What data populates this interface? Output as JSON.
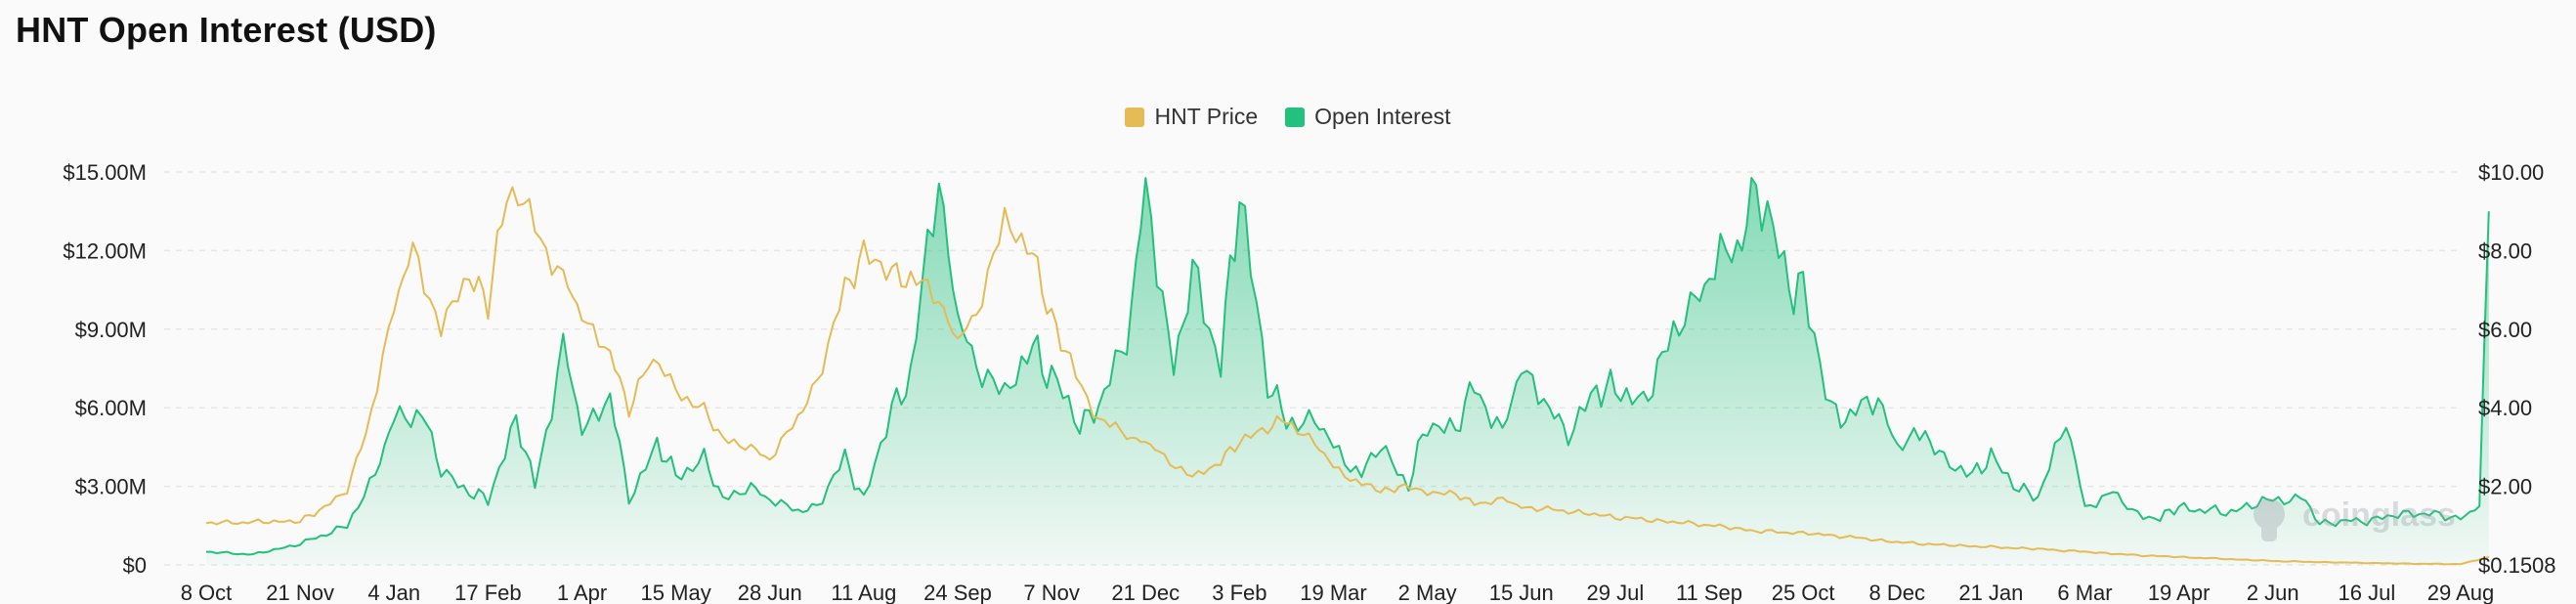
{
  "page": {
    "title": "HNT Open Interest (USD)"
  },
  "watermark": {
    "text": "coinglass"
  },
  "colors": {
    "price": "#e5bb55",
    "open_interest": "#23c07e",
    "grid": "#e6e6e6",
    "text": "#222222"
  },
  "chart_data": {
    "type": "line",
    "title": "HNT Open Interest (USD)",
    "legend_position": "top-center",
    "grid": true,
    "x_axis": {
      "ticks": [
        "8 Oct",
        "21 Nov",
        "4 Jan",
        "17 Feb",
        "1 Apr",
        "15 May",
        "28 Jun",
        "11 Aug",
        "24 Sep",
        "7 Nov",
        "21 Dec",
        "3 Feb",
        "19 Mar",
        "2 May",
        "15 Jun",
        "29 Jul",
        "11 Sep",
        "25 Oct",
        "8 Dec",
        "21 Jan",
        "6 Mar",
        "19 Apr",
        "2 Jun",
        "16 Jul",
        "29 Aug"
      ]
    },
    "y_left": {
      "range": [
        0,
        15000000
      ],
      "tick_labels": [
        "$0",
        "$3.00M",
        "$6.00M",
        "$9.00M",
        "$12.00M",
        "$15.00M"
      ]
    },
    "y_right": {
      "range": [
        0.1508,
        10
      ],
      "tick_labels": [
        "$0.1508",
        "$2.00",
        "$4.00",
        "$6.00",
        "$8.00",
        "$10.00"
      ]
    },
    "series": [
      {
        "name": "HNT Price",
        "axis": "right",
        "style": "line",
        "x_index": [
          0,
          1,
          1.2,
          1.5,
          1.7,
          2,
          2.2,
          2.5,
          2.8,
          3,
          3.2,
          3.5,
          3.8,
          4,
          4.3,
          4.5,
          4.7,
          5,
          5.3,
          5.5,
          5.8,
          6,
          6.3,
          6.5,
          6.8,
          7,
          7.3,
          7.5,
          7.8,
          8,
          8.2,
          8.5,
          8.8,
          9,
          9.2,
          9.5,
          9.8,
          10,
          10.2,
          10.5,
          10.8,
          11,
          11.3,
          11.5,
          11.8,
          12,
          12.3,
          12.5,
          12.7,
          13,
          13.3,
          13.5,
          13.8,
          14,
          14.5,
          15,
          15.5,
          16,
          16.5,
          17,
          17.5,
          18,
          18.5,
          19,
          19.5,
          20,
          20.5,
          21,
          21.5,
          22,
          22.5,
          23,
          23.5,
          24,
          24.3
        ],
        "values": [
          1.2,
          1.25,
          1.5,
          2.0,
          3.5,
          6.5,
          8.2,
          6.0,
          7.5,
          6.6,
          9.7,
          8.6,
          7.4,
          6.3,
          5.5,
          4.0,
          5.3,
          4.6,
          4.0,
          3.3,
          3.1,
          2.8,
          3.8,
          4.8,
          7.0,
          8.0,
          7.5,
          7.3,
          6.8,
          5.8,
          6.4,
          8.8,
          8.0,
          6.3,
          5.2,
          3.8,
          3.4,
          3.2,
          2.9,
          2.3,
          2.8,
          3.2,
          3.6,
          3.8,
          3.2,
          2.6,
          2.2,
          2.0,
          2.1,
          2.0,
          1.9,
          1.7,
          1.8,
          1.6,
          1.5,
          1.35,
          1.25,
          1.15,
          1.0,
          0.95,
          0.85,
          0.72,
          0.65,
          0.6,
          0.55,
          0.48,
          0.4,
          0.35,
          0.3,
          0.25,
          0.22,
          0.2,
          0.18,
          0.17,
          0.35
        ]
      },
      {
        "name": "Open Interest",
        "axis": "left",
        "style": "area",
        "x_index": [
          0,
          0.5,
          1,
          1.5,
          1.8,
          2,
          2.3,
          2.5,
          2.8,
          3,
          3.3,
          3.5,
          3.8,
          4,
          4.3,
          4.5,
          4.8,
          5,
          5.3,
          5.5,
          5.8,
          6,
          6.3,
          6.5,
          6.8,
          7,
          7.3,
          7.5,
          7.8,
          8,
          8.2,
          8.5,
          8.8,
          9,
          9.3,
          9.5,
          9.8,
          10,
          10.3,
          10.5,
          10.8,
          11,
          11.3,
          11.5,
          11.8,
          12,
          12.3,
          12.5,
          12.8,
          13,
          13.3,
          13.5,
          13.8,
          14,
          14.3,
          14.5,
          14.8,
          15,
          15.3,
          15.5,
          15.8,
          16,
          16.3,
          16.5,
          16.8,
          17,
          17.3,
          17.5,
          17.8,
          18,
          18.3,
          18.5,
          18.8,
          19,
          19.3,
          19.5,
          19.8,
          20,
          20.3,
          20.5,
          20.8,
          21,
          21.5,
          22,
          22.3,
          22.5,
          23,
          23.5,
          24,
          24.2,
          24.3
        ],
        "values": [
          500000,
          400000,
          800000,
          1500000,
          3500000,
          5500000,
          6000000,
          3500000,
          2800000,
          2500000,
          5500000,
          3000000,
          8500000,
          5000000,
          6500000,
          2500000,
          4500000,
          3500000,
          4000000,
          2500000,
          3000000,
          2500000,
          2000000,
          2300000,
          4000000,
          2500000,
          6000000,
          7200000,
          14800000,
          9500000,
          7500000,
          6500000,
          8500000,
          7000000,
          5500000,
          6000000,
          8500000,
          14500000,
          7500000,
          11000000,
          8000000,
          14000000,
          7000000,
          5500000,
          5500000,
          4500000,
          3500000,
          4500000,
          3000000,
          5500000,
          5000000,
          7000000,
          5000000,
          7500000,
          6000000,
          5000000,
          6500000,
          7000000,
          6000000,
          8000000,
          10000000,
          11000000,
          12000000,
          14800000,
          11000000,
          10500000,
          6000000,
          5500000,
          6500000,
          4500000,
          5000000,
          4000000,
          3500000,
          4000000,
          3000000,
          2500000,
          5500000,
          2200000,
          2800000,
          2000000,
          1800000,
          2200000,
          2000000,
          2500000,
          2600000,
          1600000,
          1700000,
          2000000,
          1800000,
          2200000,
          13500000
        ]
      }
    ]
  }
}
